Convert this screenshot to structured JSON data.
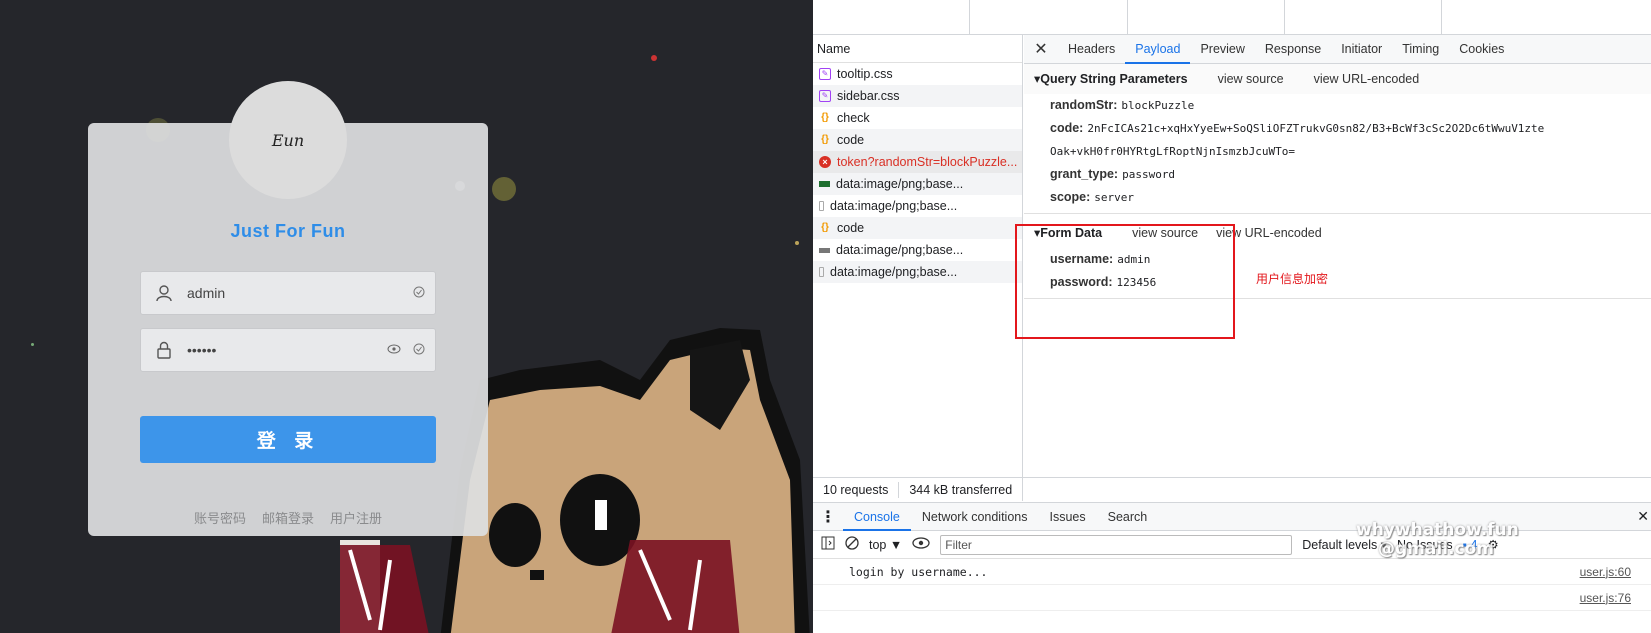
{
  "login": {
    "avatar_text": "Eun",
    "brand": "Just For Fun",
    "username_value": "admin",
    "password_value": "••••••",
    "submit_label": "登 录",
    "links": [
      "账号密码",
      "邮箱登录",
      "用户注册"
    ]
  },
  "devtools": {
    "list_header": "Name",
    "requests": [
      {
        "name": "tooltip.css",
        "type": "css"
      },
      {
        "name": "sidebar.css",
        "type": "css"
      },
      {
        "name": "check",
        "type": "js"
      },
      {
        "name": "code",
        "type": "js"
      },
      {
        "name": "token?randomStr=blockPuzzle...",
        "type": "error"
      },
      {
        "name": "data:image/png;base...",
        "type": "img"
      },
      {
        "name": "data:image/png;base...",
        "type": "img2"
      },
      {
        "name": "code",
        "type": "js"
      },
      {
        "name": "data:image/png;base...",
        "type": "img3"
      },
      {
        "name": "data:image/png;base...",
        "type": "img2"
      }
    ],
    "footer": {
      "requests": "10 requests",
      "transferred": "344 kB transferred"
    },
    "tabs": [
      "Headers",
      "Payload",
      "Preview",
      "Response",
      "Initiator",
      "Timing",
      "Cookies"
    ],
    "active_tab": "Payload",
    "query_section": {
      "title": "▾Query String Parameters",
      "view_source": "view source",
      "view_encoded": "view URL-encoded",
      "params": [
        {
          "key": "randomStr:",
          "value": "blockPuzzle"
        },
        {
          "key": "code:",
          "value": "2nFcICAs21c+xqHxYyeEw+SoQSliOFZTrukvG0sn82/B3+BcWf3cSc2O2Dc6tWwuV1zte"
        },
        {
          "key": "",
          "value": "Oak+vkH0fr0HYRtgLfRoptNjnIsmzbJcuWTo="
        },
        {
          "key": "grant_type:",
          "value": "password"
        },
        {
          "key": "scope:",
          "value": "server"
        }
      ]
    },
    "form_section": {
      "title": "▾Form Data",
      "view_source": "view source",
      "view_encoded": "view URL-encoded",
      "params": [
        {
          "key": "username:",
          "value": "admin"
        },
        {
          "key": "password:",
          "value": "123456"
        }
      ]
    },
    "annotation": "用户信息加密",
    "console": {
      "tabs": [
        "Console",
        "Network conditions",
        "Issues",
        "Search"
      ],
      "active_tab": "Console",
      "context": "top ▼",
      "filter_placeholder": "Filter",
      "levels": "Default levels ▾",
      "issues": "No Issues",
      "issue_count": "4",
      "lines": [
        {
          "msg": "login by username...",
          "src": "user.js:60"
        },
        {
          "msg": "",
          "src": "user.js:76"
        }
      ]
    },
    "watermark": [
      "whywhathow.fun",
      "@gmail.com"
    ]
  },
  "colors": {
    "accent": "#3d95ea",
    "brand": "#2e8de8",
    "error": "#d93025",
    "annotation": "#e3171c",
    "stage": "#25262b"
  }
}
